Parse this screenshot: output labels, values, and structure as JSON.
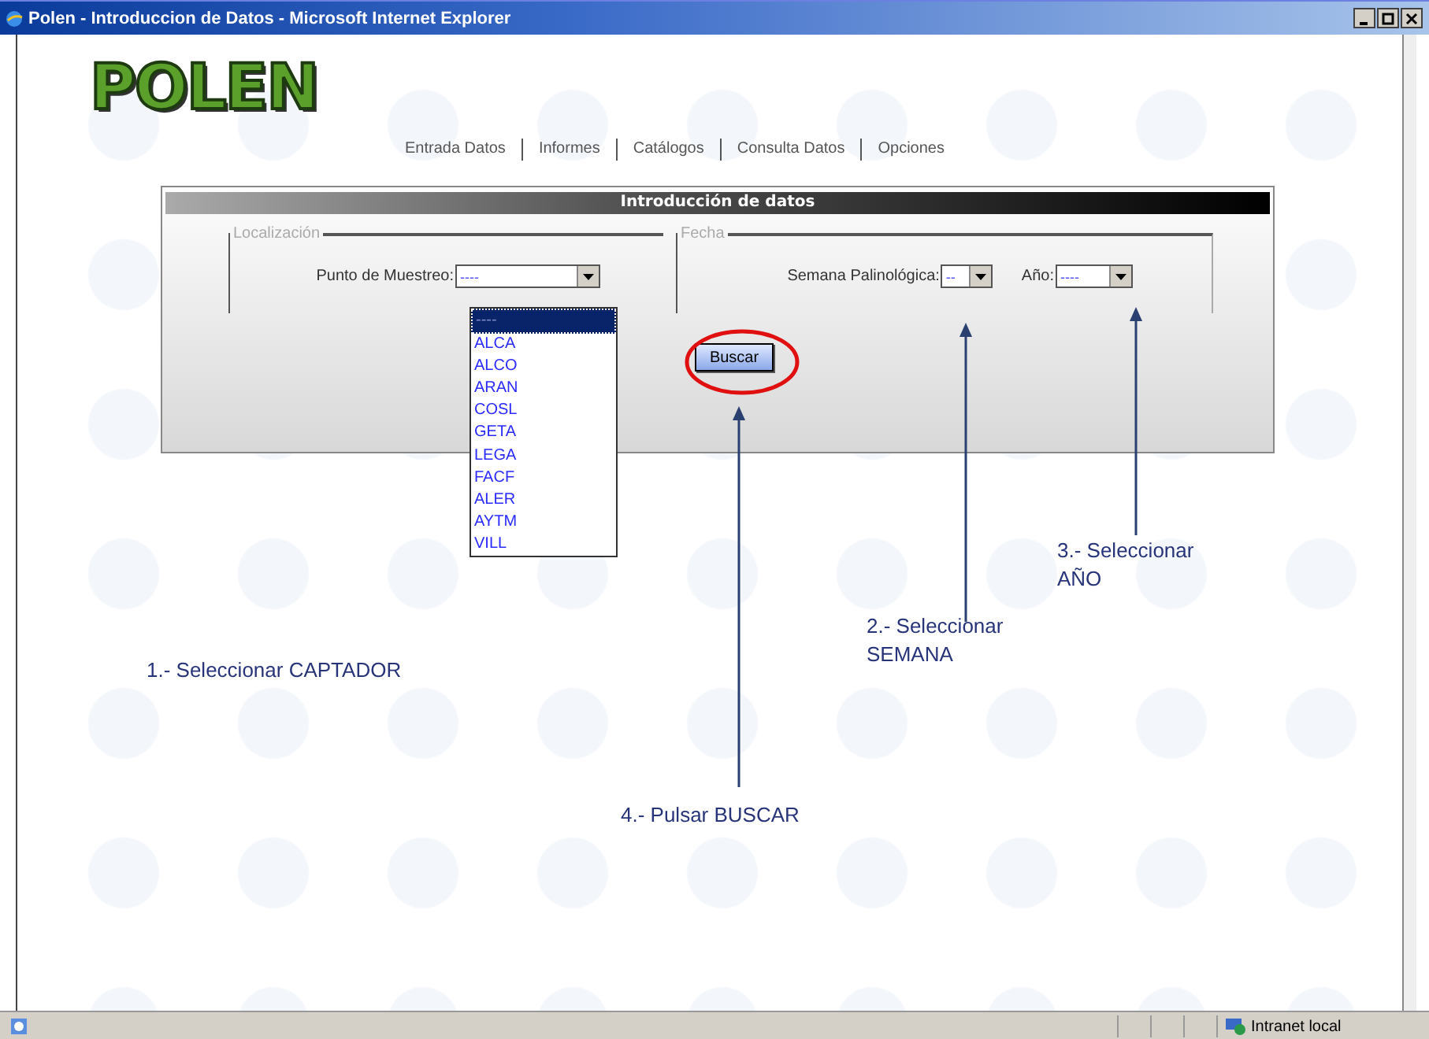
{
  "window": {
    "title": "Polen - Introduccion de Datos - Microsoft Internet Explorer"
  },
  "logo": "POLEN",
  "nav": [
    {
      "label": "Entrada Datos"
    },
    {
      "label": "Informes"
    },
    {
      "label": "Catálogos"
    },
    {
      "label": "Consulta Datos"
    },
    {
      "label": "Opciones"
    }
  ],
  "panel": {
    "title": "Introducción de datos",
    "localizacion": {
      "legend": "Localización",
      "label": "Punto de Muestreo:",
      "value": "----",
      "expanded": true,
      "options": [
        {
          "label": "----",
          "selected": true
        },
        {
          "label": "ALCA",
          "selected": false
        },
        {
          "label": "ALCO",
          "selected": false
        },
        {
          "label": "ARAN",
          "selected": false
        },
        {
          "label": "COSL",
          "selected": false
        },
        {
          "label": "GETA",
          "selected": false
        },
        {
          "label": "LEGA",
          "selected": false
        },
        {
          "label": "FACF",
          "selected": false
        },
        {
          "label": "ALER",
          "selected": false
        },
        {
          "label": "AYTM",
          "selected": false
        },
        {
          "label": "VILL",
          "selected": false
        }
      ]
    },
    "fecha": {
      "legend": "Fecha",
      "fields": [
        {
          "label": "Semana Palinológica:",
          "value": "--"
        },
        {
          "label": "Año:",
          "value": "----"
        }
      ]
    },
    "button": "Buscar"
  },
  "annotations": [
    {
      "lines": [
        "1.- Seleccionar CAPTADOR"
      ]
    },
    {
      "lines": [
        "2.- Seleccionar",
        "SEMANA"
      ]
    },
    {
      "lines": [
        "3.- Seleccionar",
        "AÑO"
      ]
    },
    {
      "lines": [
        "4.- Pulsar BUSCAR"
      ]
    }
  ],
  "status_bar": {
    "zone": "Intranet local"
  }
}
